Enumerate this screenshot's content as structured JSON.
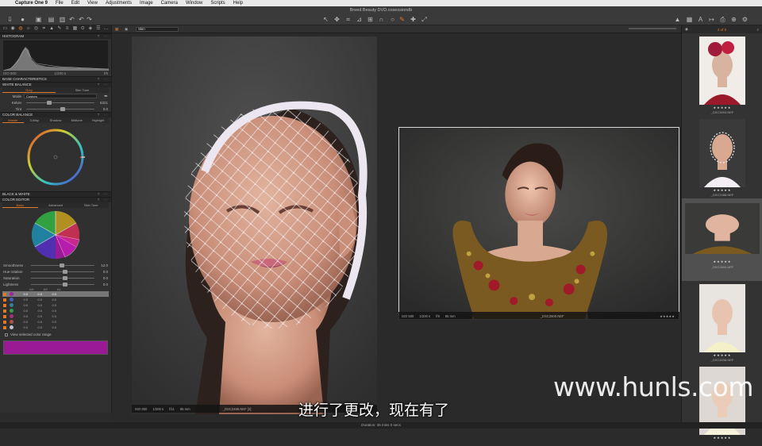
{
  "menubar": {
    "app_name": "Capture One 9",
    "items": [
      "File",
      "Edit",
      "View",
      "Adjustments",
      "Image",
      "Camera",
      "Window",
      "Scripts",
      "Help"
    ]
  },
  "window": {
    "title": "Breed Beauty DVD.cosessiondb"
  },
  "left_panel": {
    "histogram": {
      "title": "HISTOGRAM",
      "iso": "ISO 800",
      "shutter": "1/200 s",
      "extra": "f/8"
    },
    "base_characteristics": {
      "title": "BASE CHARACTERISTICS"
    },
    "white_balance": {
      "title": "WHITE BALANCE",
      "tabs": [
        "Grey",
        "Skin Tone"
      ],
      "mode_label": "Mode",
      "mode_value": "Custom",
      "kelvin_label": "Kelvin",
      "kelvin_value": "5321",
      "tint_label": "Tint",
      "tint_value": "0.0"
    },
    "color_balance": {
      "title": "COLOR BALANCE",
      "tabs": [
        "Master",
        "3-Way",
        "Shadow",
        "Midtone",
        "Highlight"
      ]
    },
    "black_white": {
      "title": "BLACK & WHITE"
    },
    "color_editor": {
      "title": "COLOR EDITOR",
      "tabs": [
        "Basic",
        "Advanced",
        "Skin Tone"
      ],
      "sliders": [
        {
          "label": "Smoothness",
          "value": "12.0"
        },
        {
          "label": "Hue rotation",
          "value": "0.0"
        },
        {
          "label": "Saturation",
          "value": "0.0"
        },
        {
          "label": "Lightness",
          "value": "0.0"
        }
      ],
      "columns": [
        "ΔH",
        "ΔS",
        "ΔL"
      ],
      "rows": [
        {
          "color": "#a020a0",
          "h": "0.0",
          "s": "0.0",
          "l": "0.0"
        },
        {
          "color": "#4060c0",
          "h": "0.0",
          "s": "0.0",
          "l": "0.0"
        },
        {
          "color": "#3080a0",
          "h": "0.0",
          "s": "0.0",
          "l": "0.0"
        },
        {
          "color": "#30a050",
          "h": "0.0",
          "s": "0.0",
          "l": "0.0"
        },
        {
          "color": "#a03080",
          "h": "0.0",
          "s": "0.0",
          "l": "0.0"
        },
        {
          "color": "#b05040",
          "h": "0.0",
          "s": "0.0",
          "l": "0.0"
        },
        {
          "color": "#c0c0d0",
          "h": "0.0",
          "s": "0.0",
          "l": "0.0"
        }
      ],
      "view_selected_label": "View selected color range",
      "swatch_color": "#9a1a96"
    }
  },
  "viewer": {
    "preset": "Skin",
    "main_photo": {
      "iso": "ISO 800",
      "shutter": "1/200 s",
      "aperture": "f/11",
      "focal": "85 mm",
      "filename": "_DSC2488.NEF [2]"
    },
    "second_photo": {
      "iso": "ISO 500",
      "shutter": "1/200 s",
      "aperture": "f/9",
      "focal": "85 mm",
      "filename": "_DSC2600.NEF",
      "stars": "★★★★★"
    }
  },
  "filmstrip": {
    "counter": "2 of 5",
    "items": [
      {
        "filename": "_DSC3493.NEF",
        "stars": "★★★★★"
      },
      {
        "filename": "_DSC2488.NEF",
        "stars": "★★★★★"
      },
      {
        "filename": "_DSC2600.NEF",
        "stars": "★★★★★"
      },
      {
        "filename": "_DSC4938.NEF",
        "stars": "★★★★★"
      },
      {
        "filename": "",
        "stars": "★★★★★"
      }
    ]
  },
  "statusbar": {
    "text": "Duration: 35 mins 0 secs"
  },
  "overlay": {
    "subtitle": "进行了更改，现在有了",
    "watermark": "www.hunls.com"
  },
  "colors": {
    "accent": "#e07a2a",
    "panel": "#303030",
    "background": "#2b2b2b"
  }
}
